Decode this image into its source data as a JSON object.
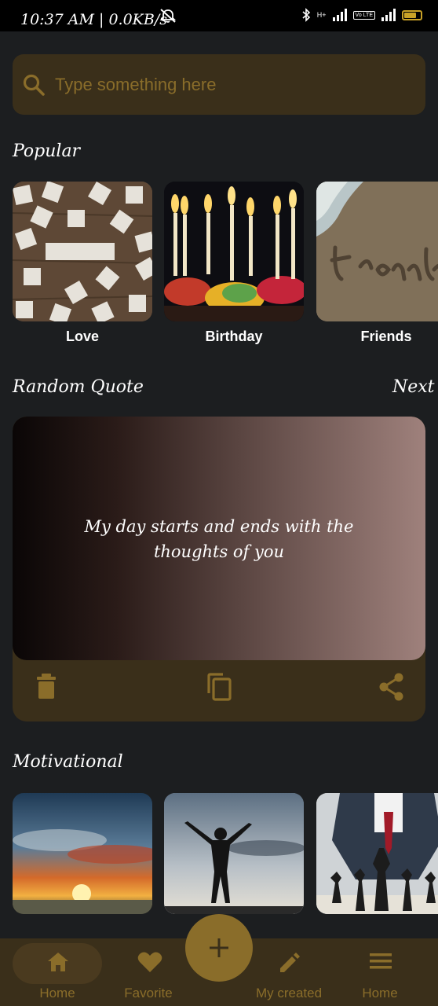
{
  "status_bar": {
    "time_speed": "10:37 AM | 0.0KB/s",
    "network_1": "H+",
    "network_2": "Vo LTE",
    "battery_level": 0.7
  },
  "search": {
    "placeholder": "Type something here"
  },
  "popular": {
    "title": "Popular",
    "items": [
      {
        "label": "Love"
      },
      {
        "label": "Birthday"
      },
      {
        "label": "Friends"
      }
    ]
  },
  "random_quote": {
    "title": "Random Quote",
    "next_label": "Next",
    "quote": "My day starts and ends with the thoughts of you",
    "actions": [
      "delete-icon",
      "copy-icon",
      "share-icon"
    ]
  },
  "motivational": {
    "title": "Motivational"
  },
  "bottom_nav": {
    "items": [
      {
        "label": "Home",
        "icon": "home-icon"
      },
      {
        "label": "Favorite",
        "icon": "heart-icon"
      },
      {
        "label": "My created",
        "icon": "pencil-icon"
      },
      {
        "label": "Home",
        "icon": "menu-icon"
      }
    ],
    "fab_icon": "plus-icon"
  },
  "colors": {
    "background": "#1c1e20",
    "accent": "#8a6d2a",
    "surface": "#3a2f1a"
  }
}
